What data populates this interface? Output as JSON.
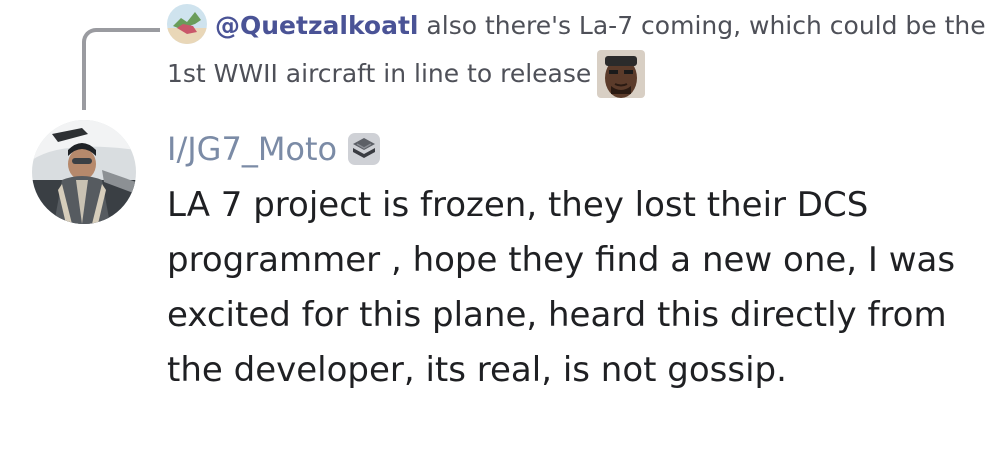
{
  "reply": {
    "mention": "@Quetzalkoatl",
    "text": "also there's La-7 coming, which could be the 1st WWII aircraft in line to release",
    "emoji": "snoop-dogg-emoji"
  },
  "message": {
    "username": "I/JG7_Moto",
    "badge_icon": "server-role-badge-icon",
    "body": "LA 7 project is frozen, they lost their DCS programmer , hope they find a new one, I was excited for this plane, heard this directly from the developer, its real, is not gossip."
  },
  "colors": {
    "mention": "#4a5396",
    "username": "#7b8ba6",
    "body_text": "#1f2023",
    "reply_text": "#4e5058",
    "spine": "#9a9ba0"
  }
}
